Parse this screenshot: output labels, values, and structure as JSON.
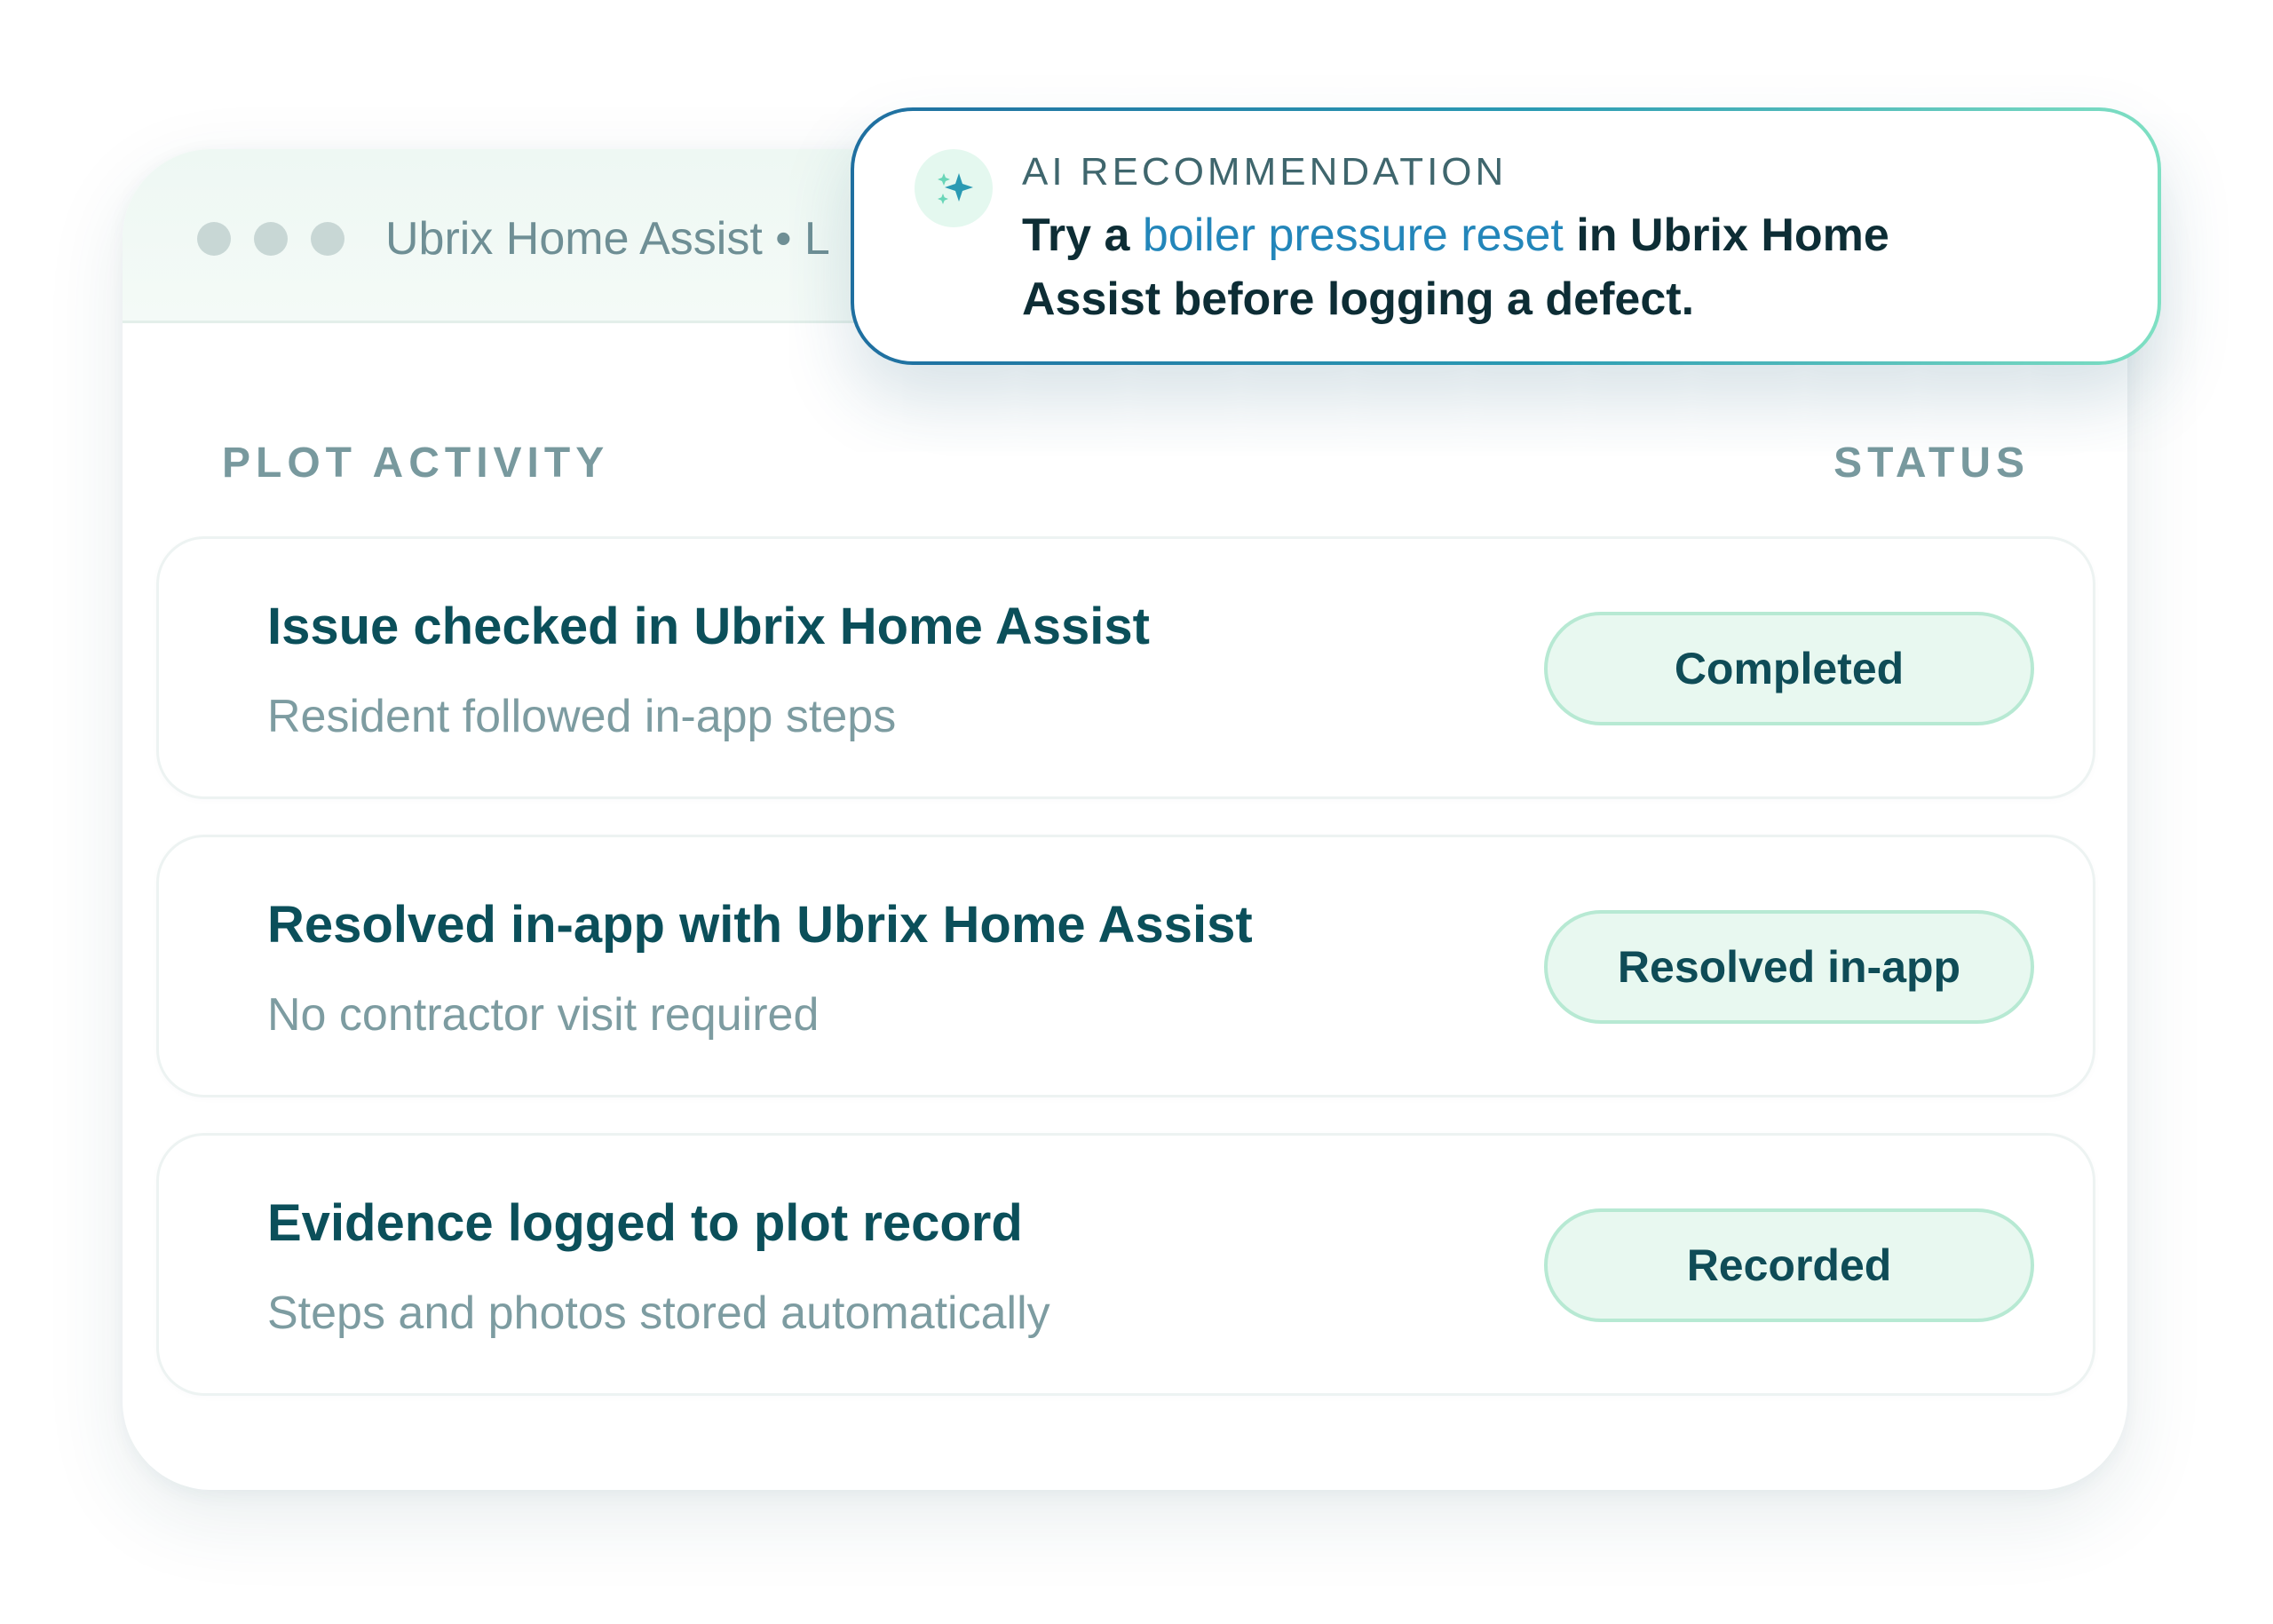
{
  "window": {
    "title": "Ubrix Home Assist • L"
  },
  "recommendation": {
    "label": "AI RECOMMENDATION",
    "prefix": "Try a",
    "link_text": "boiler pressure reset",
    "suffix": "in Ubrix Home Assist before logging a defect.",
    "icon": "sparkles-icon"
  },
  "activity": {
    "heading": "PLOT ACTIVITY",
    "status_heading": "STATUS",
    "items": [
      {
        "title": "Issue checked in Ubrix Home Assist",
        "subtitle": "Resident followed in-app steps",
        "status": "Completed"
      },
      {
        "title": "Resolved in-app with Ubrix Home Assist",
        "subtitle": "No contractor visit required",
        "status": "Resolved in-app"
      },
      {
        "title": "Evidence logged to plot record",
        "subtitle": "Steps and photos stored automatically",
        "status": "Recorded"
      }
    ]
  },
  "colors": {
    "primary_text": "#0b4f5a",
    "muted_text": "#7d9ca1",
    "accent_link": "#2386ba",
    "success_bg": "#e8f8f0",
    "success_border": "#b7e9d3"
  }
}
